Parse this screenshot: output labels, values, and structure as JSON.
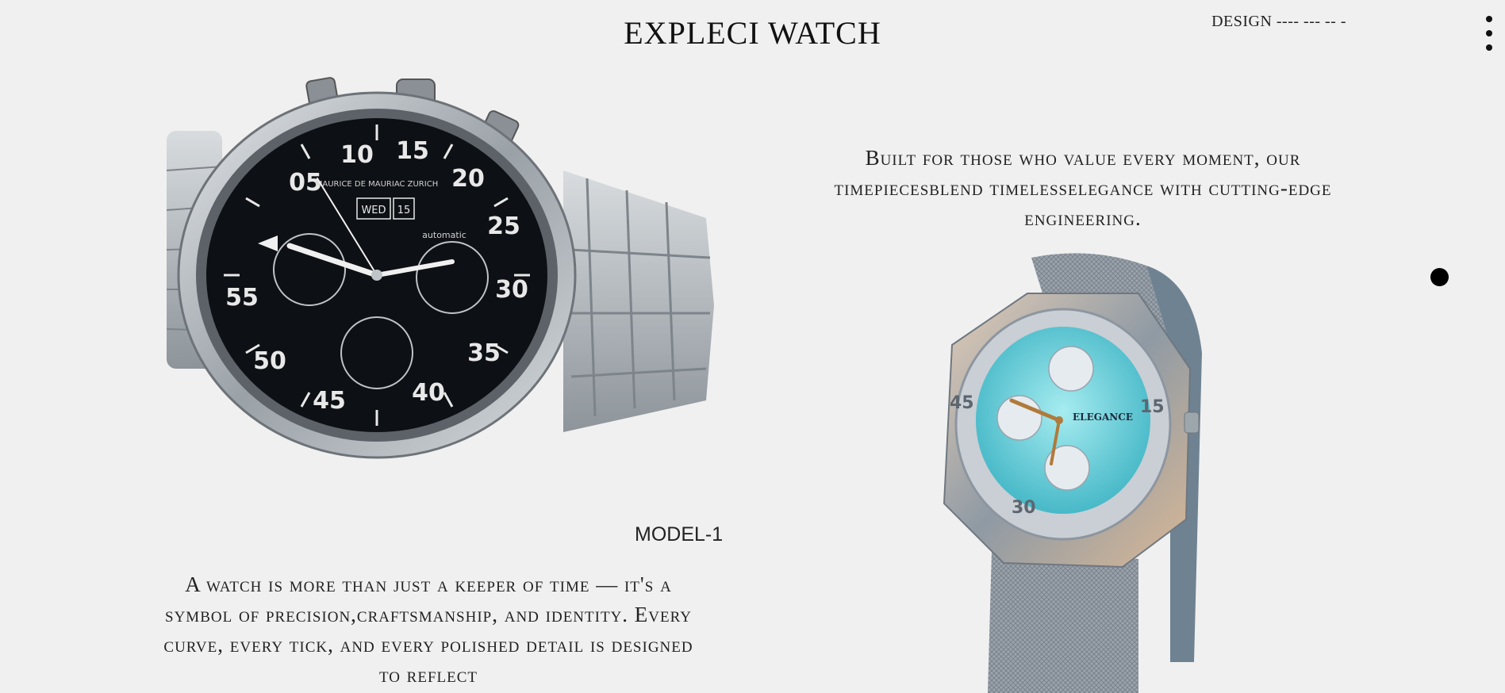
{
  "header": {
    "brand": "EXPLECI WATCH",
    "design_label": "DESIGN ---- --- -- -",
    "menu_icon": "kebab-vertical-icon"
  },
  "hero": {
    "tagline": "Built for those who value every moment, our timepiecesblend timelesselegance with cutting-edge engineering."
  },
  "product": {
    "model_label": "MODEL-1",
    "description": "A watch is more than just a keeper of time — it's a symbol of precision,craftsmanship, and identity. Every curve, every tick, and every polished detail is designed to reflect"
  },
  "watch_1": {
    "dial_numbers": [
      "05",
      "10",
      "15",
      "20",
      "25",
      "30",
      "35",
      "40",
      "45",
      "50",
      "55"
    ],
    "brand_text": "MAURICE DE MAURIAC ZURICH",
    "date_day": "WED",
    "date_num": "15",
    "dial_note": "automatic",
    "colors": {
      "dial": "#0d1014",
      "steel": "#aab0b5",
      "marker": "#e8e8e8"
    }
  },
  "watch_2": {
    "brand_text": "ELEGANCE",
    "bezel_numbers": [
      "45",
      "15",
      "30"
    ],
    "colors": {
      "dial": "#6fd3dc",
      "case": "#c9a88a",
      "strap": "#8c96a0"
    }
  },
  "colors": {
    "background": "#f0f0f0",
    "text": "#1a1a1a",
    "dot": "#000000"
  }
}
